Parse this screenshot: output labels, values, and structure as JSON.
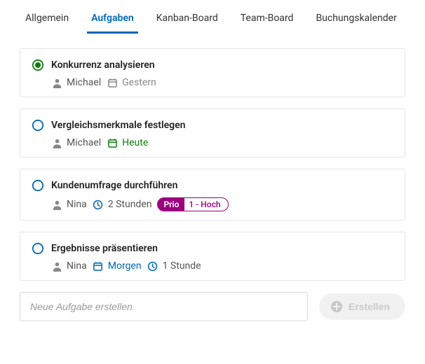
{
  "tabs": [
    {
      "label": "Allgemein",
      "active": false
    },
    {
      "label": "Aufgaben",
      "active": true
    },
    {
      "label": "Kanban-Board",
      "active": false
    },
    {
      "label": "Team-Board",
      "active": false
    },
    {
      "label": "Buchungskalender",
      "active": false
    }
  ],
  "tasks": [
    {
      "title": "Konkurrenz analysieren",
      "done": true,
      "assignee": "Michael",
      "date": {
        "label": "Gestern",
        "color": "#888"
      }
    },
    {
      "title": "Vergleichsmerkmale festlegen",
      "done": false,
      "assignee": "Michael",
      "date": {
        "label": "Heute",
        "color": "#107c10"
      }
    },
    {
      "title": "Kundenumfrage durchführen",
      "done": false,
      "assignee": "Nina",
      "duration": "2 Stunden",
      "priority": {
        "label": "Prio",
        "value": "1 - Hoch"
      }
    },
    {
      "title": "Ergebnisse präsentieren",
      "done": false,
      "assignee": "Nina",
      "date": {
        "label": "Morgen",
        "color": "#0067b8"
      },
      "duration": "1 Stunde"
    }
  ],
  "newTask": {
    "placeholder": "Neue Aufgabe erstellen",
    "button": "Erstellen"
  },
  "colors": {
    "primary": "#0067b8",
    "green": "#107c10",
    "purple": "#9b007e",
    "muted": "#888"
  }
}
